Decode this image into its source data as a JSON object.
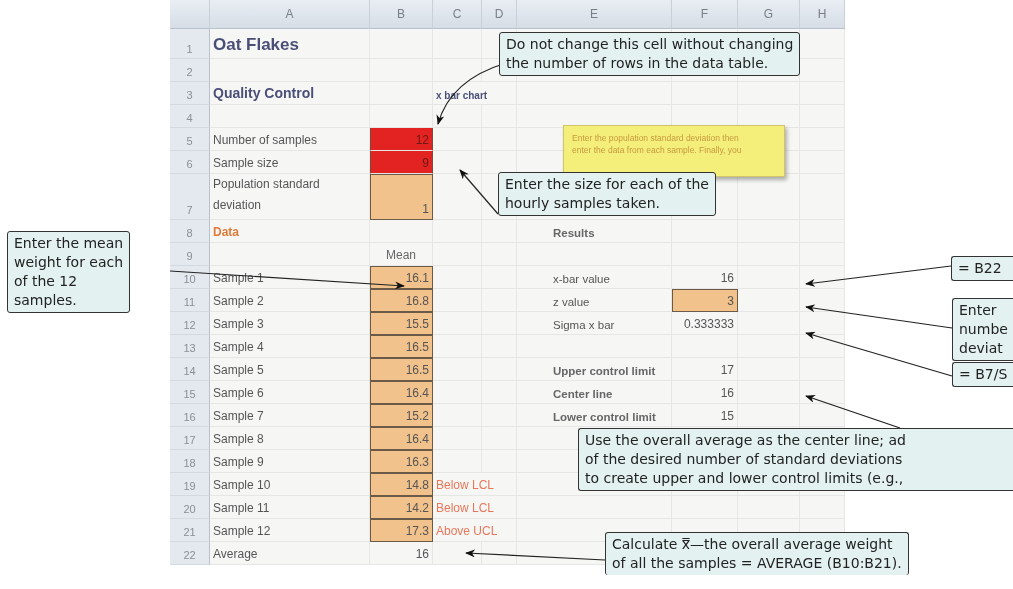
{
  "sheet": {
    "column_headers": [
      "A",
      "B",
      "C",
      "D",
      "E",
      "F",
      "G",
      "H"
    ],
    "rows": [
      {
        "number": "1",
        "a": {
          "text": "Oat Flakes",
          "kind": "title"
        }
      },
      {
        "number": "2"
      },
      {
        "number": "3",
        "a": {
          "text": "Quality Control",
          "kind": "heading"
        },
        "c": {
          "text": "x bar chart",
          "kind": "heading-small"
        }
      },
      {
        "number": "4"
      },
      {
        "number": "5",
        "a": {
          "text": "Number of samples",
          "kind": "plain"
        },
        "b": {
          "text": "12",
          "kind": "key-input"
        }
      },
      {
        "number": "6",
        "a": {
          "text": "Sample size",
          "kind": "plain"
        },
        "b": {
          "text": "9",
          "kind": "key-input"
        }
      },
      {
        "number": "7",
        "a": {
          "text": "Population standard deviation",
          "kind": "plain"
        },
        "b": {
          "text": "1",
          "kind": "input"
        }
      },
      {
        "number": "8",
        "a": {
          "text": "Data",
          "kind": "section"
        },
        "e": {
          "text": "Results",
          "kind": "bold-label"
        }
      },
      {
        "number": "9",
        "b": {
          "text": "Mean",
          "kind": "column-head"
        }
      },
      {
        "number": "10",
        "a": {
          "text": "Sample 1",
          "kind": "plain"
        },
        "b": {
          "text": "16.1",
          "kind": "input"
        },
        "e": {
          "text": "x-bar value",
          "kind": "plain"
        },
        "f": {
          "text": "16",
          "kind": "plain"
        }
      },
      {
        "number": "11",
        "a": {
          "text": "Sample 2",
          "kind": "plain"
        },
        "b": {
          "text": "16.8",
          "kind": "input"
        },
        "e": {
          "text": "z value",
          "kind": "plain"
        },
        "f": {
          "text": "3",
          "kind": "input"
        }
      },
      {
        "number": "12",
        "a": {
          "text": "Sample 3",
          "kind": "plain"
        },
        "b": {
          "text": "15.5",
          "kind": "input"
        },
        "e": {
          "text": "Sigma x bar",
          "kind": "plain"
        },
        "f": {
          "text": "0.333333",
          "kind": "plain"
        }
      },
      {
        "number": "13",
        "a": {
          "text": "Sample 4",
          "kind": "plain"
        },
        "b": {
          "text": "16.5",
          "kind": "input"
        }
      },
      {
        "number": "14",
        "a": {
          "text": "Sample 5",
          "kind": "plain"
        },
        "b": {
          "text": "16.5",
          "kind": "input"
        },
        "e": {
          "text": "Upper control limit",
          "kind": "bold-label"
        },
        "f": {
          "text": "17",
          "kind": "plain"
        }
      },
      {
        "number": "15",
        "a": {
          "text": "Sample 6",
          "kind": "plain"
        },
        "b": {
          "text": "16.4",
          "kind": "input"
        },
        "e": {
          "text": "Center line",
          "kind": "bold-label"
        },
        "f": {
          "text": "16",
          "kind": "plain"
        }
      },
      {
        "number": "16",
        "a": {
          "text": "Sample 7",
          "kind": "plain"
        },
        "b": {
          "text": "15.2",
          "kind": "input"
        },
        "e": {
          "text": "Lower control limit",
          "kind": "bold-label"
        },
        "f": {
          "text": "15",
          "kind": "plain"
        }
      },
      {
        "number": "17",
        "a": {
          "text": "Sample 8",
          "kind": "plain"
        },
        "b": {
          "text": "16.4",
          "kind": "input"
        }
      },
      {
        "number": "18",
        "a": {
          "text": "Sample 9",
          "kind": "plain"
        },
        "b": {
          "text": "16.3",
          "kind": "input"
        }
      },
      {
        "number": "19",
        "a": {
          "text": "Sample 10",
          "kind": "plain"
        },
        "b": {
          "text": "14.8",
          "kind": "input"
        },
        "c": {
          "text": "Below LCL",
          "kind": "flag"
        }
      },
      {
        "number": "20",
        "a": {
          "text": "Sample 11",
          "kind": "plain"
        },
        "b": {
          "text": "14.2",
          "kind": "input"
        },
        "c": {
          "text": "Below LCL",
          "kind": "flag"
        }
      },
      {
        "number": "21",
        "a": {
          "text": "Sample 12",
          "kind": "plain"
        },
        "b": {
          "text": "17.3",
          "kind": "input"
        },
        "c": {
          "text": "Above UCL",
          "kind": "flag"
        }
      },
      {
        "number": "22",
        "a": {
          "text": "Average",
          "kind": "plain"
        },
        "b": {
          "text": "16",
          "kind": "plain"
        }
      }
    ],
    "note": {
      "lines": [
        "Enter the population standard deviation then",
        "enter the data from each sample. Finally, you"
      ]
    }
  },
  "callouts": [
    {
      "lines": [
        "Do not change this cell without changing",
        "the number of rows in the data table."
      ]
    },
    {
      "lines": [
        "Enter the size for each of the",
        "hourly samples taken."
      ]
    },
    {
      "lines": [
        "Enter the mean",
        "weight for each",
        "of the 12",
        "samples."
      ]
    },
    {
      "lines": [
        "= B22"
      ]
    },
    {
      "lines": [
        "Enter",
        "numbe",
        "deviat"
      ]
    },
    {
      "lines": [
        "= B7/S"
      ]
    },
    {
      "lines": [
        "Use the overall average as the center line; ad",
        "of the desired number of standard deviations",
        "to create upper and lower control limits (e.g.,"
      ]
    },
    {
      "lines": [
        "Calculate x̿—the overall average weight",
        "of all the samples = AVERAGE (B10:B21)."
      ]
    }
  ]
}
